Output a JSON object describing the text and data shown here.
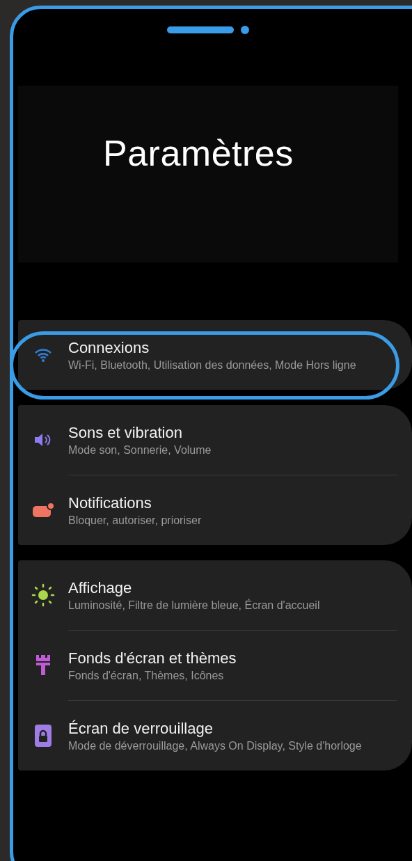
{
  "title": "Paramètres",
  "groups": [
    {
      "items": [
        {
          "kind": "wifi",
          "title": "Connexions",
          "subtitle": "Wi-Fi, Bluetooth, Utilisation des données, Mode Hors ligne",
          "highlighted": true
        }
      ]
    },
    {
      "items": [
        {
          "kind": "sound",
          "title": "Sons et vibration",
          "subtitle": "Mode son, Sonnerie, Volume",
          "highlighted": false
        },
        {
          "kind": "notification",
          "title": "Notifications",
          "subtitle": "Bloquer, autoriser, prioriser",
          "highlighted": false
        }
      ]
    },
    {
      "items": [
        {
          "kind": "display",
          "title": "Affichage",
          "subtitle": "Luminosité, Filtre de lumière bleue, Écran d'accueil",
          "highlighted": false
        },
        {
          "kind": "theme",
          "title": "Fonds d'écran et thèmes",
          "subtitle": "Fonds d'écran, Thèmes, Icônes",
          "highlighted": false
        },
        {
          "kind": "lock",
          "title": "Écran de verrouillage",
          "subtitle": "Mode de déverrouillage, Always On Display, Style d'horloge",
          "highlighted": false
        }
      ]
    }
  ]
}
